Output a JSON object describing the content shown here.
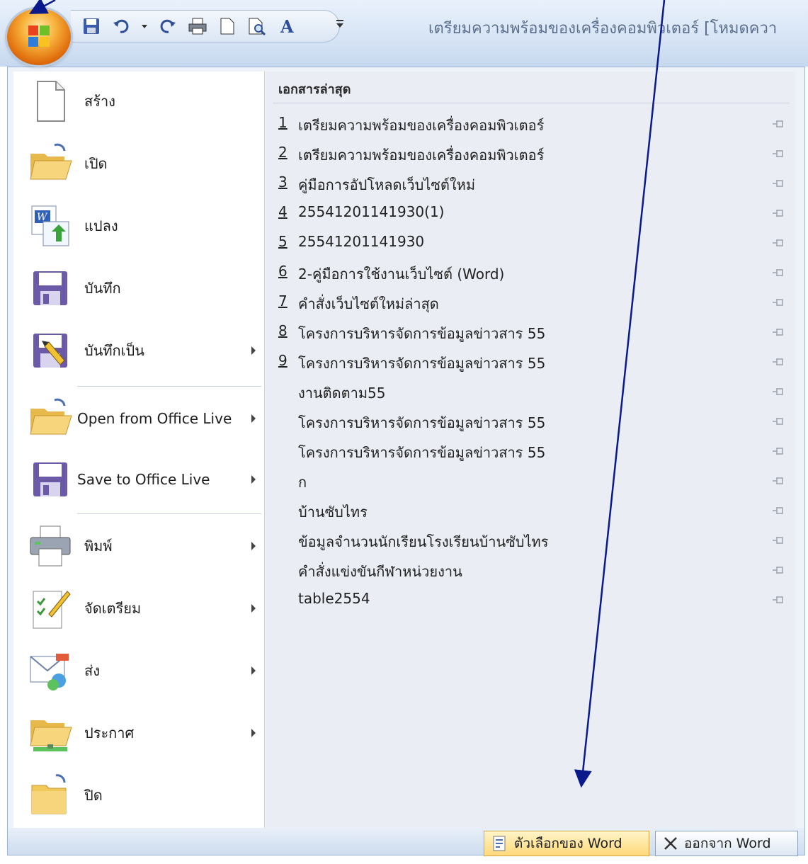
{
  "title_bar": {
    "document_title": "เตรียมความพร้อมของเครื่องคอมพิวเตอร์ [โหมดควา"
  },
  "quick_access": {
    "icons": [
      "save-icon",
      "undo-icon",
      "dropdown-icon",
      "redo-icon",
      "print-icon",
      "new-document-icon",
      "print-preview-icon",
      "font-icon",
      "customize-icon"
    ]
  },
  "menu": {
    "items": [
      {
        "label": "สร้าง",
        "icon": "new-document-icon"
      },
      {
        "label": "เปิด",
        "icon": "open-folder-icon"
      },
      {
        "label": "แปลง",
        "icon": "convert-icon"
      },
      {
        "label": "บันทึก",
        "icon": "save-icon"
      },
      {
        "label": "บันทึกเป็น",
        "icon": "save-as-icon",
        "submenu": true
      },
      {
        "label": "Open from Office Live",
        "icon": "open-folder-icon",
        "submenu": true
      },
      {
        "label": "Save to Office Live",
        "icon": "save-icon",
        "submenu": true
      },
      {
        "label": "พิมพ์",
        "icon": "printer-icon",
        "submenu": true
      },
      {
        "label": "จัดเตรียม",
        "icon": "prepare-icon",
        "submenu": true
      },
      {
        "label": "ส่ง",
        "icon": "send-icon",
        "submenu": true
      },
      {
        "label": "ประกาศ",
        "icon": "publish-icon",
        "submenu": true
      },
      {
        "label": "ปิด",
        "icon": "close-folder-icon"
      }
    ]
  },
  "recent": {
    "heading": "เอกสารล่าสุด",
    "items": [
      {
        "num": "1",
        "text": "เตรียมความพร้อมของเครื่องคอมพิวเตอร์"
      },
      {
        "num": "2",
        "text": "เตรียมความพร้อมของเครื่องคอมพิวเตอร์"
      },
      {
        "num": "3",
        "text": "คู่มือการอัปโหลดเว็บไซต์ใหม่"
      },
      {
        "num": "4",
        "text": "25541201141930(1)"
      },
      {
        "num": "5",
        "text": "25541201141930"
      },
      {
        "num": "6",
        "text": "2-คู่มือการใช้งานเว็บไซต์ (Word)"
      },
      {
        "num": "7",
        "text": "คำสั่งเว็บไซต์ใหม่ล่าสุด"
      },
      {
        "num": "8",
        "text": "โครงการบริหารจัดการข้อมูลข่าวสาร 55"
      },
      {
        "num": "9",
        "text": "โครงการบริหารจัดการข้อมูลข่าวสาร 55"
      },
      {
        "num": "",
        "text": "งานติดตาม55"
      },
      {
        "num": "",
        "text": "โครงการบริหารจัดการข้อมูลข่าวสาร 55"
      },
      {
        "num": "",
        "text": "โครงการบริหารจัดการข้อมูลข่าวสาร 55"
      },
      {
        "num": "",
        "text": "ก"
      },
      {
        "num": "",
        "text": "บ้านซับไทร"
      },
      {
        "num": "",
        "text": "ข้อมูลจำนวนนักเรียนโรงเรียนบ้านซับไทร"
      },
      {
        "num": "",
        "text": "คำสั่งแข่งขันกีฬาหน่วยงาน"
      },
      {
        "num": "",
        "text": "table2554"
      }
    ]
  },
  "bottom": {
    "options_label": "ตัวเลือกของ Word",
    "exit_label": "ออกจาก Word"
  },
  "colors": {
    "accent_orange": "#e06d0c",
    "arrow_blue": "#0a1a8c",
    "ribbon_blue": "#d6e4f5"
  }
}
